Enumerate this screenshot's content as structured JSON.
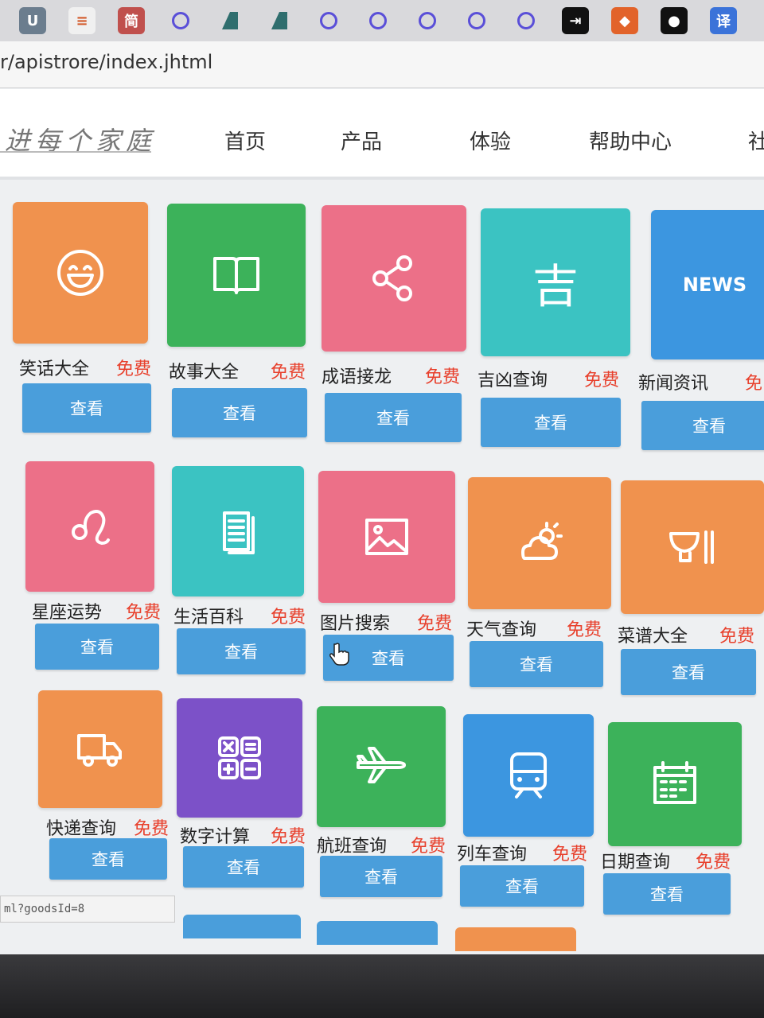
{
  "browser": {
    "extensions": [
      {
        "name": "ublock-icon",
        "kind": "tile",
        "color": "#6b7d8e",
        "glyph": "U"
      },
      {
        "name": "stack-icon",
        "kind": "tile",
        "color": "#f0f0f0",
        "glyph": "≡"
      },
      {
        "name": "jian-icon",
        "kind": "tile",
        "color": "#c0504d",
        "glyph": "简"
      },
      {
        "name": "compass-icon",
        "kind": "circle"
      },
      {
        "name": "sail-icon",
        "kind": "sail"
      },
      {
        "name": "sail-icon",
        "kind": "sail"
      },
      {
        "name": "compass-icon",
        "kind": "circle"
      },
      {
        "name": "compass-icon",
        "kind": "circle"
      },
      {
        "name": "compass-icon",
        "kind": "circle"
      },
      {
        "name": "compass-icon",
        "kind": "circle"
      },
      {
        "name": "compass-icon",
        "kind": "circle"
      },
      {
        "name": "arrow-box-icon",
        "kind": "tile",
        "color": "#111111",
        "glyph": "⇥"
      },
      {
        "name": "gitlab-icon",
        "kind": "tile",
        "color": "#e2632a",
        "glyph": "◆"
      },
      {
        "name": "github-icon",
        "kind": "tile",
        "color": "#111111",
        "glyph": "●"
      },
      {
        "name": "translate-icon",
        "kind": "tile",
        "color": "#3b73d9",
        "glyph": "译"
      }
    ],
    "url": "r/apistrore/index.jhtml",
    "status_url": "ml?goodsId=8"
  },
  "header": {
    "logo_text": "进每个家庭",
    "nav": [
      "首页",
      "产品",
      "体验",
      "帮助中心",
      "社"
    ]
  },
  "products": [
    {
      "name": "笑话大全",
      "price": "免费",
      "button": "查看",
      "icon": "smile-icon",
      "color": "#f0924e"
    },
    {
      "name": "故事大全",
      "price": "免费",
      "button": "查看",
      "icon": "book-icon",
      "color": "#3cb25a"
    },
    {
      "name": "成语接龙",
      "price": "免费",
      "button": "查看",
      "icon": "share-icon",
      "color": "#ec7088"
    },
    {
      "name": "吉凶查询",
      "price": "免费",
      "button": "查看",
      "icon": "ji-icon",
      "icon_text": "吉",
      "color": "#3bc3c2"
    },
    {
      "name": "新闻资讯",
      "price": "免",
      "button": "查看",
      "icon": "news-icon",
      "icon_text": "NEWS",
      "color": "#3c96e0"
    },
    {
      "name": "星座运势",
      "price": "免费",
      "button": "查看",
      "icon": "leo-icon",
      "color": "#ec7088"
    },
    {
      "name": "生活百科",
      "price": "免费",
      "button": "查看",
      "icon": "document-icon",
      "color": "#3bc3c2"
    },
    {
      "name": "图片搜索",
      "price": "免费",
      "button": "查看",
      "icon": "image-icon",
      "color": "#ec7088"
    },
    {
      "name": "天气查询",
      "price": "免费",
      "button": "查看",
      "icon": "weather-icon",
      "color": "#f0924e"
    },
    {
      "name": "菜谱大全",
      "price": "免费",
      "button": "查看",
      "icon": "bowl-icon",
      "color": "#f0924e"
    },
    {
      "name": "快递查询",
      "price": "免费",
      "button": "查看",
      "icon": "truck-icon",
      "color": "#f0924e"
    },
    {
      "name": "数字计算",
      "price": "免费",
      "button": "查看",
      "icon": "calculator-icon",
      "color": "#7c51c8"
    },
    {
      "name": "航班查询",
      "price": "免费",
      "button": "查看",
      "icon": "plane-icon",
      "color": "#3cb25a"
    },
    {
      "name": "列车查询",
      "price": "免费",
      "button": "查看",
      "icon": "train-icon",
      "color": "#3c96e0"
    },
    {
      "name": "日期查询",
      "price": "免费",
      "button": "查看",
      "icon": "calendar-icon",
      "color": "#3cb25a"
    }
  ]
}
